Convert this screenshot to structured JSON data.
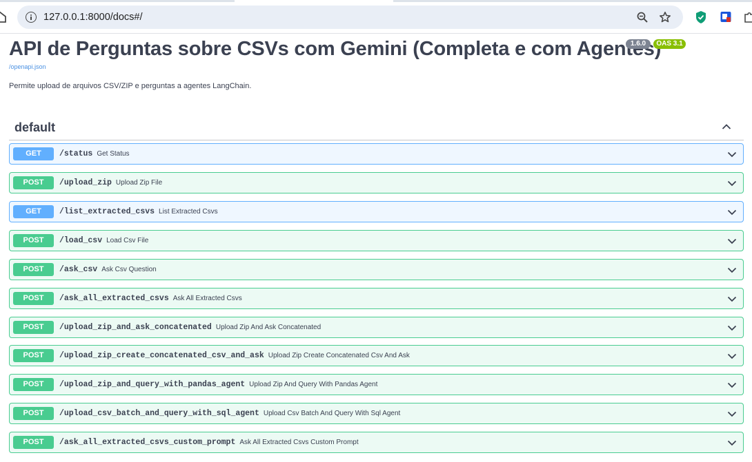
{
  "browser": {
    "url": "127.0.0.1:8000/docs#/"
  },
  "info": {
    "title": "API de Perguntas sobre CSVs com Gemini (Completa e com Agentes)",
    "version": "1.6.0",
    "oas": "OAS 3.1",
    "spec_link": "/openapi.json",
    "description": "Permite upload de arquivos CSV/ZIP e perguntas a agentes LangChain."
  },
  "tag": {
    "name": "default"
  },
  "operations": [
    {
      "method": "GET",
      "path": "/status",
      "summary": "Get Status"
    },
    {
      "method": "POST",
      "path": "/upload_zip",
      "summary": "Upload Zip File"
    },
    {
      "method": "GET",
      "path": "/list_extracted_csvs",
      "summary": "List Extracted Csvs"
    },
    {
      "method": "POST",
      "path": "/load_csv",
      "summary": "Load Csv File"
    },
    {
      "method": "POST",
      "path": "/ask_csv",
      "summary": "Ask Csv Question"
    },
    {
      "method": "POST",
      "path": "/ask_all_extracted_csvs",
      "summary": "Ask All Extracted Csvs"
    },
    {
      "method": "POST",
      "path": "/upload_zip_and_ask_concatenated",
      "summary": "Upload Zip And Ask Concatenated"
    },
    {
      "method": "POST",
      "path": "/upload_zip_create_concatenated_csv_and_ask",
      "summary": "Upload Zip Create Concatenated Csv And Ask"
    },
    {
      "method": "POST",
      "path": "/upload_zip_and_query_with_pandas_agent",
      "summary": "Upload Zip And Query With Pandas Agent"
    },
    {
      "method": "POST",
      "path": "/upload_csv_batch_and_query_with_sql_agent",
      "summary": "Upload Csv Batch And Query With Sql Agent"
    },
    {
      "method": "POST",
      "path": "/ask_all_extracted_csvs_custom_prompt",
      "summary": "Ask All Extracted Csvs Custom Prompt"
    }
  ],
  "colors": {
    "get": "#61affe",
    "post": "#49cc90",
    "version_badge": "#7d8492",
    "oas_badge": "#89bf04"
  }
}
